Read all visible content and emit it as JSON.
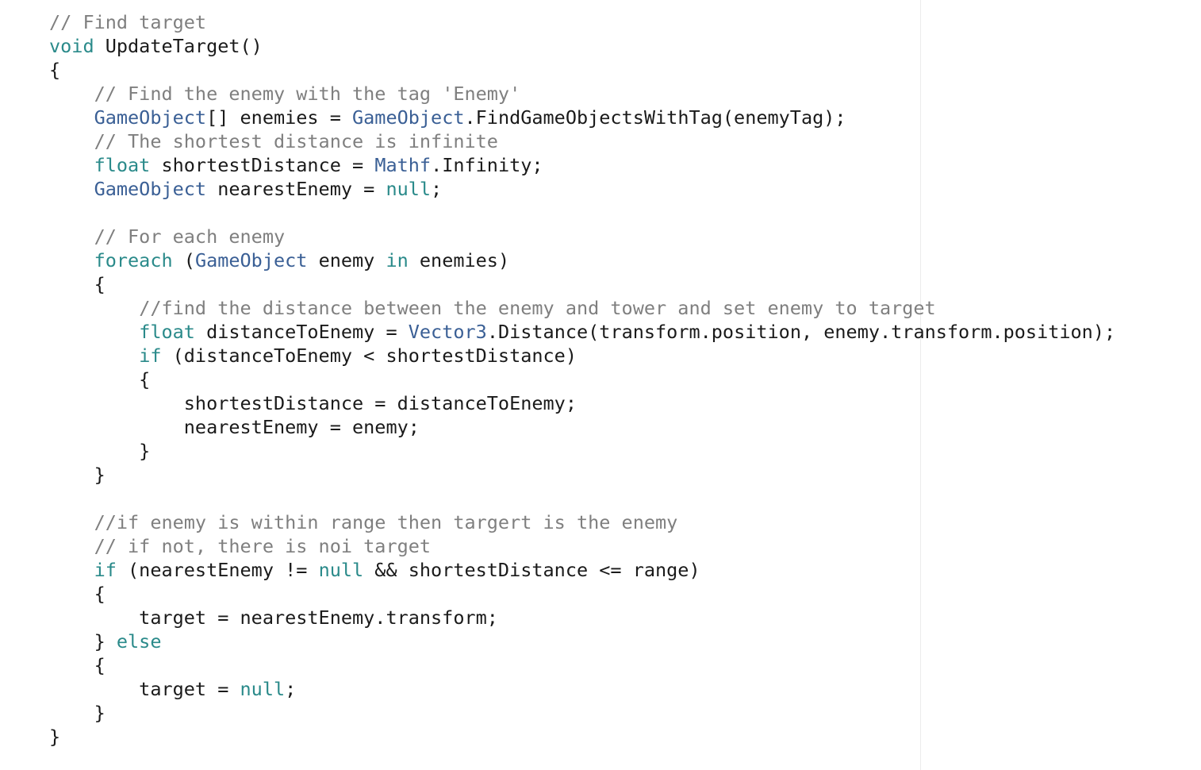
{
  "colors": {
    "background": "#ffffff",
    "plain": "#1a1a1a",
    "comment": "#7f7f7f",
    "keyword": "#2a8a8a",
    "type": "#3a5f95",
    "guide": "#ececec"
  },
  "code_lines": [
    [
      {
        "t": "comment",
        "s": "// Find target"
      }
    ],
    [
      {
        "t": "keyword",
        "s": "void"
      },
      {
        "t": "plain",
        "s": " UpdateTarget()"
      }
    ],
    [
      {
        "t": "plain",
        "s": "{"
      }
    ],
    [
      {
        "t": "plain",
        "s": "    "
      },
      {
        "t": "comment",
        "s": "// Find the enemy with the tag 'Enemy'"
      }
    ],
    [
      {
        "t": "plain",
        "s": "    "
      },
      {
        "t": "type",
        "s": "GameObject"
      },
      {
        "t": "plain",
        "s": "[] enemies = "
      },
      {
        "t": "type",
        "s": "GameObject"
      },
      {
        "t": "plain",
        "s": ".FindGameObjectsWithTag(enemyTag);"
      }
    ],
    [
      {
        "t": "plain",
        "s": "    "
      },
      {
        "t": "comment",
        "s": "// The shortest distance is infinite"
      }
    ],
    [
      {
        "t": "plain",
        "s": "    "
      },
      {
        "t": "keyword",
        "s": "float"
      },
      {
        "t": "plain",
        "s": " shortestDistance = "
      },
      {
        "t": "type",
        "s": "Mathf"
      },
      {
        "t": "plain",
        "s": ".Infinity;"
      }
    ],
    [
      {
        "t": "plain",
        "s": "    "
      },
      {
        "t": "type",
        "s": "GameObject"
      },
      {
        "t": "plain",
        "s": " nearestEnemy = "
      },
      {
        "t": "keyword",
        "s": "null"
      },
      {
        "t": "plain",
        "s": ";"
      }
    ],
    [],
    [
      {
        "t": "plain",
        "s": "    "
      },
      {
        "t": "comment",
        "s": "// For each enemy"
      }
    ],
    [
      {
        "t": "plain",
        "s": "    "
      },
      {
        "t": "keyword",
        "s": "foreach"
      },
      {
        "t": "plain",
        "s": " ("
      },
      {
        "t": "type",
        "s": "GameObject"
      },
      {
        "t": "plain",
        "s": " enemy "
      },
      {
        "t": "keyword",
        "s": "in"
      },
      {
        "t": "plain",
        "s": " enemies)"
      }
    ],
    [
      {
        "t": "plain",
        "s": "    {"
      }
    ],
    [
      {
        "t": "plain",
        "s": "        "
      },
      {
        "t": "comment",
        "s": "//find the distance between the enemy and tower and set enemy to target"
      }
    ],
    [
      {
        "t": "plain",
        "s": "        "
      },
      {
        "t": "keyword",
        "s": "float"
      },
      {
        "t": "plain",
        "s": " distanceToEnemy = "
      },
      {
        "t": "type",
        "s": "Vector3"
      },
      {
        "t": "plain",
        "s": ".Distance(transform.position, enemy.transform.position);"
      }
    ],
    [
      {
        "t": "plain",
        "s": "        "
      },
      {
        "t": "keyword",
        "s": "if"
      },
      {
        "t": "plain",
        "s": " (distanceToEnemy < shortestDistance)"
      }
    ],
    [
      {
        "t": "plain",
        "s": "        {"
      }
    ],
    [
      {
        "t": "plain",
        "s": "            shortestDistance = distanceToEnemy;"
      }
    ],
    [
      {
        "t": "plain",
        "s": "            nearestEnemy = enemy;"
      }
    ],
    [
      {
        "t": "plain",
        "s": "        }"
      }
    ],
    [
      {
        "t": "plain",
        "s": "    }"
      }
    ],
    [],
    [
      {
        "t": "plain",
        "s": "    "
      },
      {
        "t": "comment",
        "s": "//if enemy is within range then targert is the enemy"
      }
    ],
    [
      {
        "t": "plain",
        "s": "    "
      },
      {
        "t": "comment",
        "s": "// if not, there is noi target"
      }
    ],
    [
      {
        "t": "plain",
        "s": "    "
      },
      {
        "t": "keyword",
        "s": "if"
      },
      {
        "t": "plain",
        "s": " (nearestEnemy != "
      },
      {
        "t": "keyword",
        "s": "null"
      },
      {
        "t": "plain",
        "s": " && shortestDistance <= range)"
      }
    ],
    [
      {
        "t": "plain",
        "s": "    {"
      }
    ],
    [
      {
        "t": "plain",
        "s": "        target = nearestEnemy.transform;"
      }
    ],
    [
      {
        "t": "plain",
        "s": "    } "
      },
      {
        "t": "keyword",
        "s": "else"
      }
    ],
    [
      {
        "t": "plain",
        "s": "    {"
      }
    ],
    [
      {
        "t": "plain",
        "s": "        target = "
      },
      {
        "t": "keyword",
        "s": "null"
      },
      {
        "t": "plain",
        "s": ";"
      }
    ],
    [
      {
        "t": "plain",
        "s": "    }"
      }
    ],
    [
      {
        "t": "plain",
        "s": "}"
      }
    ]
  ]
}
